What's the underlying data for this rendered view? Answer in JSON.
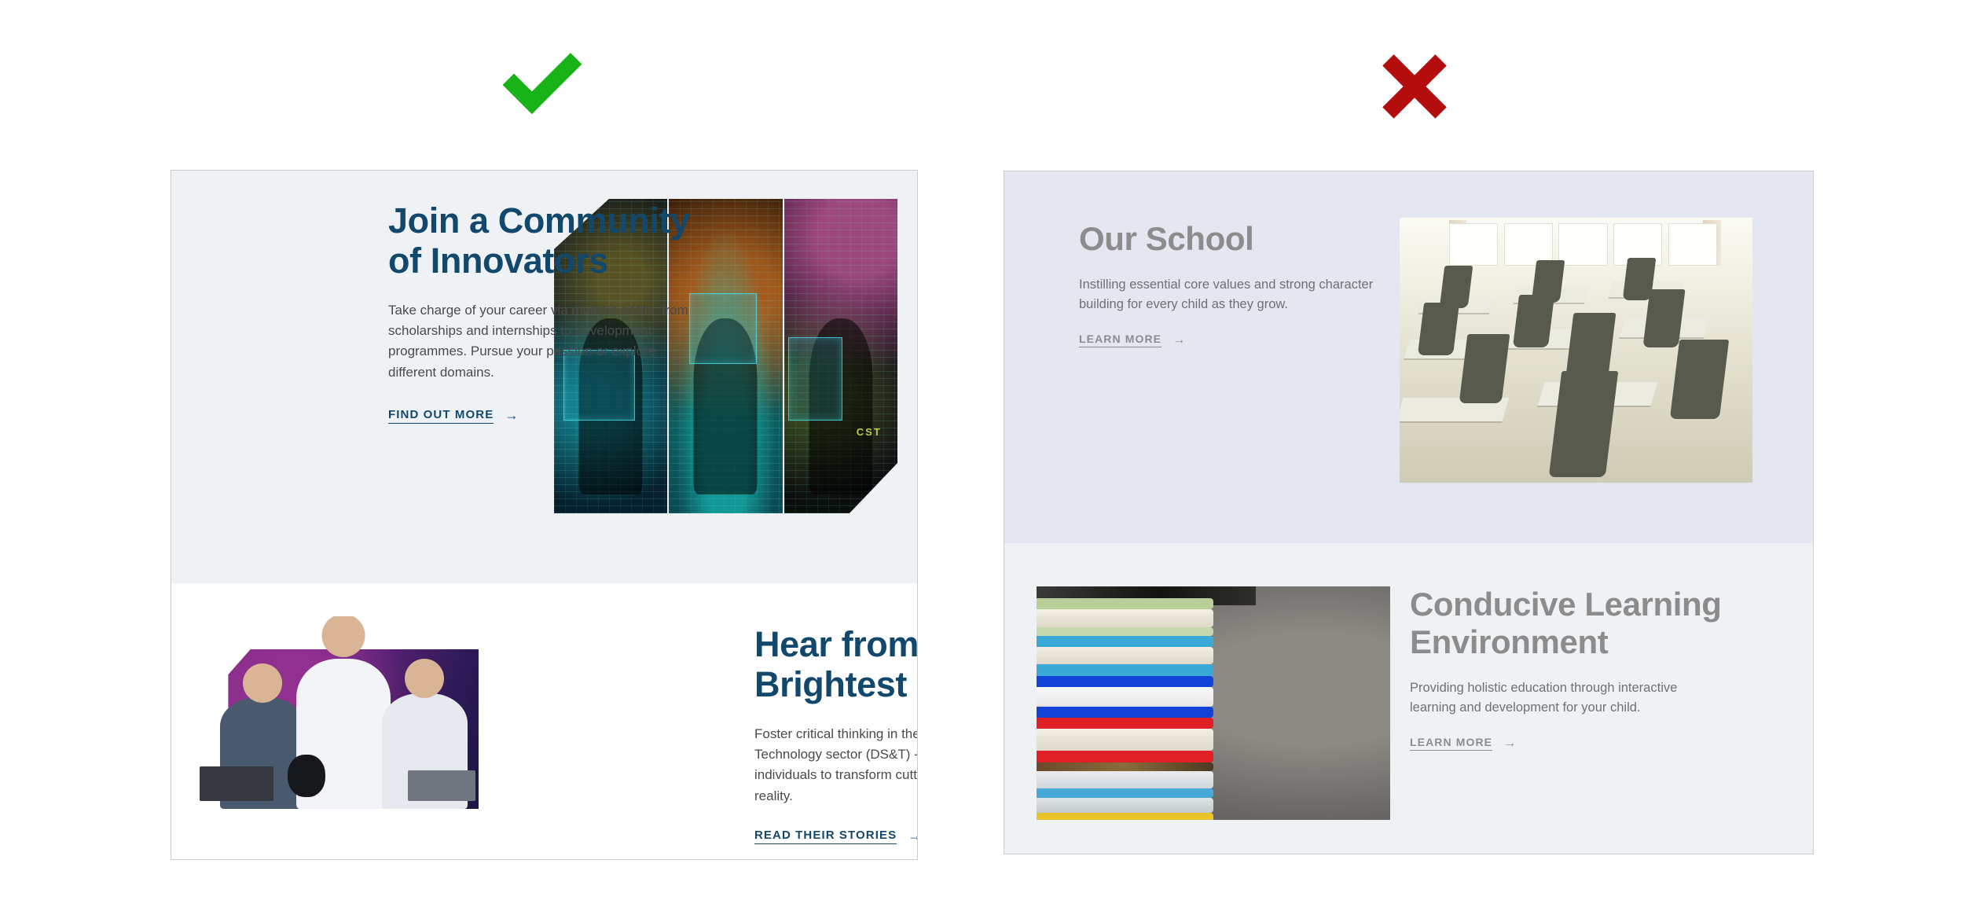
{
  "marks": {
    "good": {
      "icon": "check-mark-icon",
      "color": "#17b317",
      "meaning": "good example"
    },
    "bad": {
      "icon": "cross-mark-icon",
      "color": "#b30d0d",
      "meaning": "bad example"
    }
  },
  "good_card": {
    "sections": [
      {
        "heading": "Join a Community of Innovators",
        "body": "Take charge of your career via multiple paths, from scholarships and internships to development programmes. Pursue your passion or explore different domains.",
        "cta_label": "FIND OUT MORE",
        "cta_arrow": "→",
        "media_alt": "three-panel technology collage",
        "media_caption": "CST"
      },
      {
        "heading": "Hear from Our Brightest Minds",
        "body": "Foster critical thinking in the Defence Science & Technology sector (DS&T) - a place that empowers individuals to transform cutting-edge ideas to reality.",
        "cta_label": "READ THEIR STORIES",
        "cta_arrow": "→",
        "media_alt": "three researchers on purple background"
      }
    ],
    "colors": {
      "heading": "#12486b",
      "body": "#4a4a4a",
      "cta": "#12486b",
      "panel_top_bg": "#eff2f5",
      "panel_bottom_bg": "#ffffff",
      "border": "#c9ccd1"
    }
  },
  "bad_card": {
    "sections": [
      {
        "heading": "Our School",
        "body": "Instilling essential core values and strong character building for every child as they grow.",
        "cta_label": "LEARN MORE",
        "cta_arrow": "→",
        "media_alt": "empty classroom with desks and chairs"
      },
      {
        "heading": "Conducive Learning Environment",
        "body": "Providing holistic education through interactive learning and development for your child.",
        "cta_label": "LEARN MORE",
        "cta_arrow": "→",
        "media_alt": "stack of colourful books"
      }
    ],
    "colors": {
      "heading": "#8c8c8c",
      "body": "#6f7076",
      "cta": "#8c8c8c",
      "panel_top_bg": "#e4e7f0",
      "panel_bottom_bg": "#eff2f5",
      "border": "#c9ccd1"
    }
  }
}
